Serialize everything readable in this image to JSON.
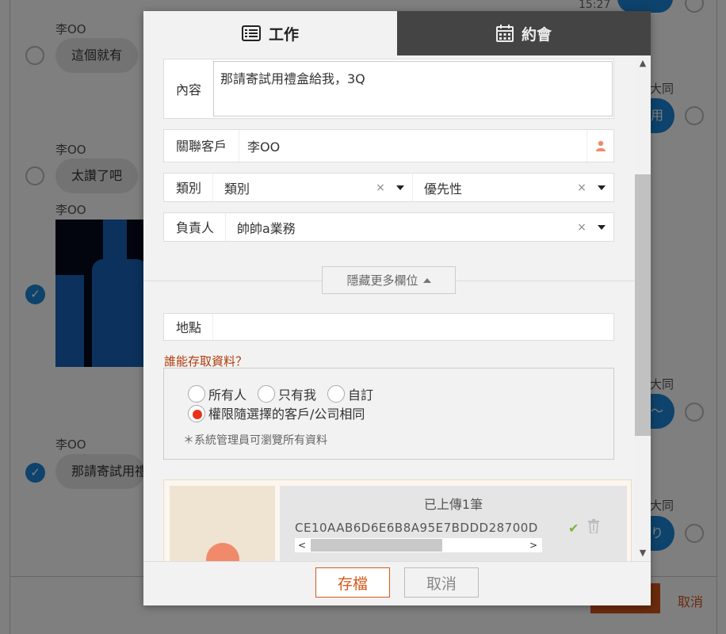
{
  "background": {
    "time": "15:27",
    "messages": [
      {
        "sender": "李OO",
        "text": "這個就有"
      },
      {
        "sender": "李OO",
        "text": "太讚了吧"
      },
      {
        "sender": "李OO",
        "text": ""
      },
      {
        "sender": "李OO",
        "text": "那請寄試用禮"
      }
    ],
    "right_names": [
      "大同",
      "大同",
      "大同"
    ],
    "right_bubbles": [
      "用",
      "〜",
      "り"
    ],
    "cancel_label": "取消"
  },
  "tabs": [
    {
      "label": "工作",
      "icon": "list-icon",
      "active": true
    },
    {
      "label": "約會",
      "icon": "calendar-icon",
      "active": false
    }
  ],
  "form": {
    "content": {
      "label": "內容",
      "value": "那請寄試用禮盒給我，3Q"
    },
    "customer": {
      "label": "關聯客戶",
      "value": "李OO"
    },
    "category": {
      "label": "類別",
      "value": "類別",
      "priority_value": "優先性",
      "clear": "×"
    },
    "owner": {
      "label": "負責人",
      "value": "帥帥a業務",
      "clear": "×"
    },
    "toggle_more": "隱藏更多欄位",
    "location": {
      "label": "地點",
      "value": ""
    },
    "access": {
      "title": "誰能存取資料？",
      "options": [
        "所有人",
        "只有我",
        "自訂",
        "權限隨選擇的客戶/公司相同"
      ],
      "selected": "權限隨選擇的客戶/公司相同",
      "note": "＊系統管理員可瀏覽所有資料"
    },
    "upload": {
      "count": "已上傳1筆",
      "filename": "CE10AAB6D6E6B8A95E7BDDD28700D"
    }
  },
  "footer": {
    "save": "存檔",
    "cancel": "取消"
  },
  "colors": {
    "accent": "#d6571a",
    "tab_inactive": "#444444",
    "check_blue": "#1a86d8",
    "radio_on": "#e8331a"
  }
}
